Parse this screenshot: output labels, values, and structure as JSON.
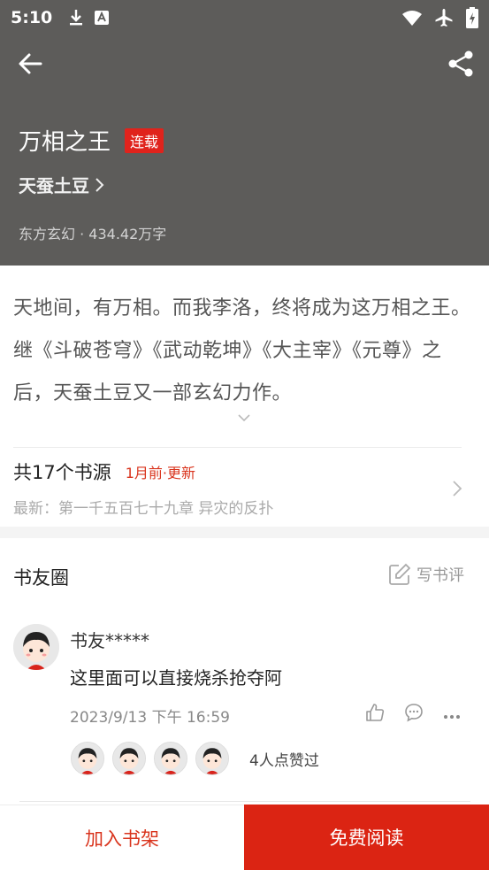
{
  "status": {
    "time": "5:10"
  },
  "book": {
    "title": "万相之王",
    "badge": "连载",
    "author": "天蚕土豆",
    "genre": "东方玄幻",
    "separator": "·",
    "word_count": "434.42万字"
  },
  "synopsis": {
    "text": "天地间，有万相。而我李洛，终将成为这万相之王。继《斗破苍穹》《武动乾坤》《大主宰》《元尊》之后，天蚕土豆又一部玄幻力作。"
  },
  "sources": {
    "count_label": "共17个书源",
    "updated_label": "1月前·更新",
    "latest_label": "最新：第一千五百七十九章 异灾的反扑"
  },
  "circle": {
    "title": "书友圈",
    "write_review": "写书评",
    "comment": {
      "user": "书友*****",
      "text": "这里面可以直接烧杀抢夺阿",
      "time": "2023/9/13 下午 16:59",
      "likes_label": "4人点赞过"
    }
  },
  "bottom": {
    "add_shelf": "加入书架",
    "free_read": "免费阅读"
  },
  "colors": {
    "header_bg": "#5d5c5a",
    "accent_red": "#db2413",
    "badge_red": "#e0231c"
  }
}
